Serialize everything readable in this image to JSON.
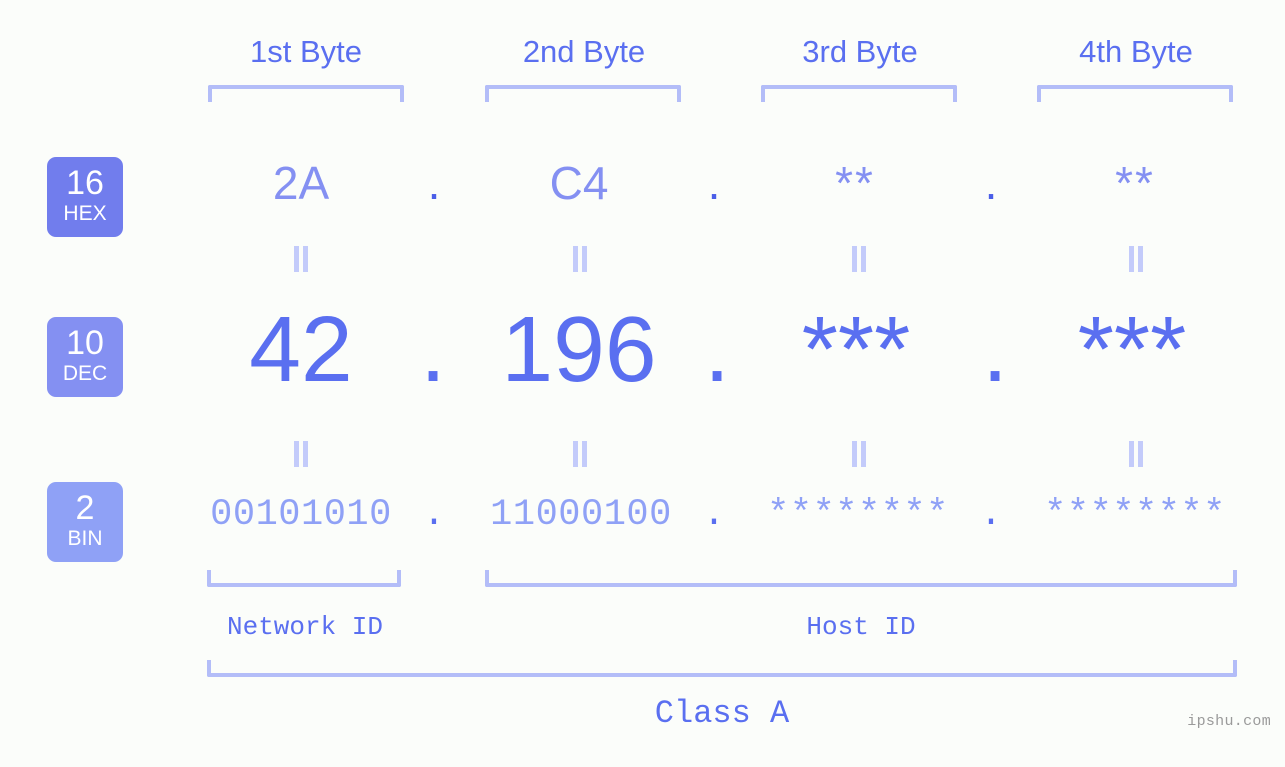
{
  "meta": {
    "background_color": "#fbfdfa",
    "accent_color": "#5a6ff0",
    "accent_light_color": "#8fa1f6",
    "bracket_color": "#b3bdf8",
    "watermark": "ipshu.com"
  },
  "header": {
    "byte_labels": [
      "1st Byte",
      "2nd Byte",
      "3rd Byte",
      "4th Byte"
    ]
  },
  "bases": [
    {
      "number": "16",
      "name": "HEX",
      "badge_color": "#717ded"
    },
    {
      "number": "10",
      "name": "DEC",
      "badge_color": "#8490f2"
    },
    {
      "number": "2",
      "name": "BIN",
      "badge_color": "#8fa1f6"
    }
  ],
  "rows": {
    "hex": {
      "values": [
        "2A",
        "C4",
        "**",
        "**"
      ],
      "separator": "."
    },
    "dec": {
      "values": [
        "42",
        "196",
        "***",
        "***"
      ],
      "separator": "."
    },
    "bin": {
      "values": [
        "00101010",
        "11000100",
        "********",
        "********"
      ],
      "separator": "."
    }
  },
  "equals_symbol": "=",
  "footer": {
    "network_id_label": "Network ID",
    "host_id_label": "Host ID",
    "class_label": "Class A"
  }
}
